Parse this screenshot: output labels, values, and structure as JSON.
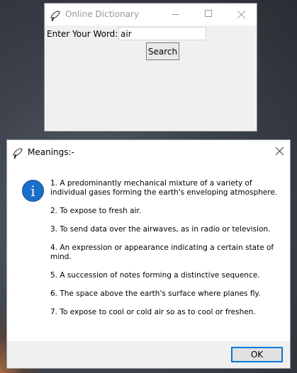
{
  "main_window": {
    "title": "Online Dictionary",
    "prompt_label": "Enter Your Word:-",
    "word_value": "air",
    "search_label": "Search"
  },
  "dialog": {
    "title": "Meanings:-",
    "icon": "info-icon",
    "meanings": [
      "1. A predominantly mechanical mixture of a variety of individual gases forming the earth's enveloping atmosphere.",
      "2. To expose to fresh air.",
      "3. To send data over the airwaves, as in radio or television.",
      "4. An expression or appearance indicating a certain state of mind.",
      "5. A succession of notes forming a distinctive sequence.",
      "6. The space above the earth's surface where planes fly.",
      "7. To expose to cool or cold air so as to cool or freshen."
    ],
    "ok_label": "OK"
  },
  "colors": {
    "accent": "#0078d7",
    "info_icon": "#1a6fc8"
  }
}
